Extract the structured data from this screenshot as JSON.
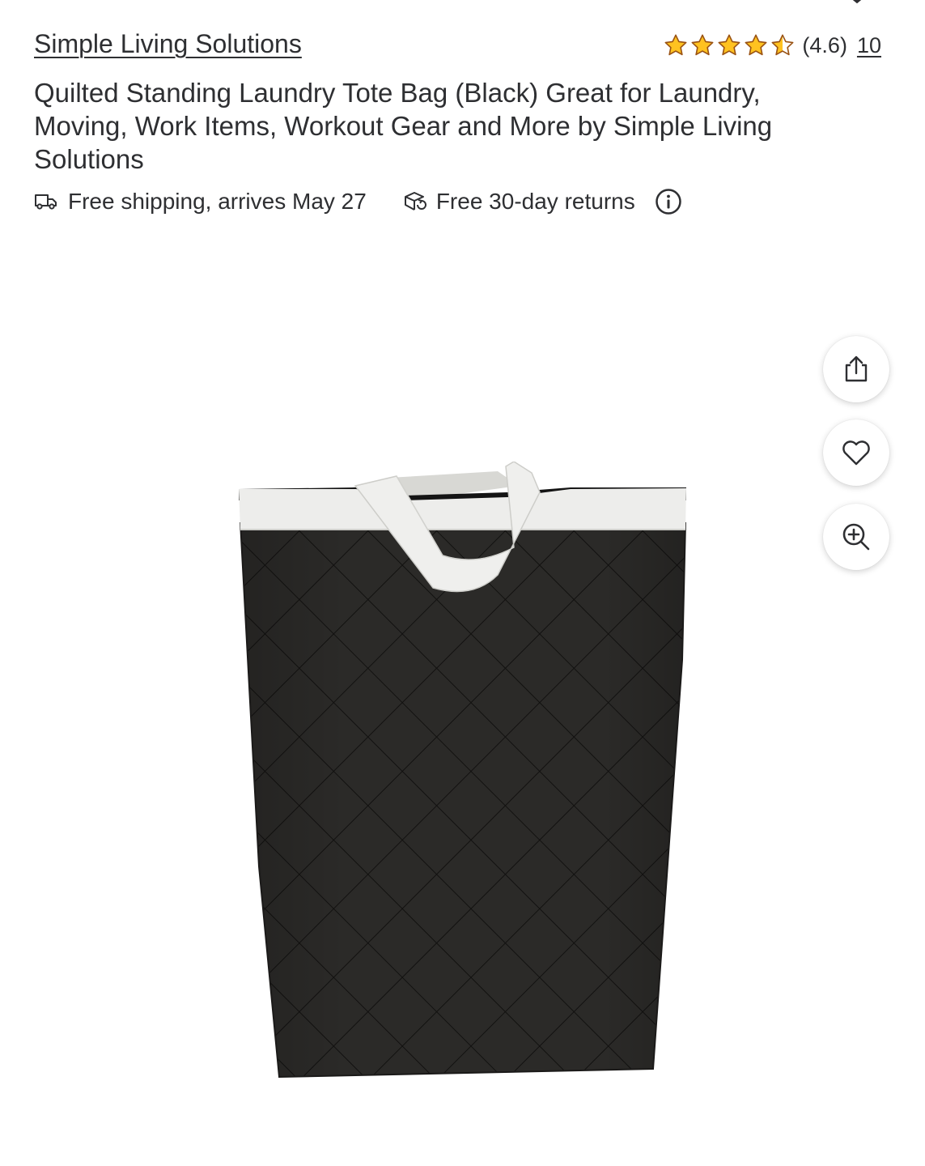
{
  "header": {
    "brand": "Simple Living Solutions",
    "rating_value": "(4.6)",
    "rating_stars": 4.6,
    "review_count": "10"
  },
  "product": {
    "title": "Quilted Standing Laundry Tote Bag (Black) Great for Laundry, Moving, Work Items, Workout Gear and More by Simple Living Solutions"
  },
  "fulfillment": {
    "shipping": "Free shipping, arrives May 27",
    "returns": "Free 30-day returns"
  },
  "icons": {
    "close": "close-icon",
    "shipping": "truck-icon",
    "returns": "return-box-icon",
    "info": "info-icon",
    "share": "share-icon",
    "favorite": "heart-icon",
    "zoom": "zoom-in-icon"
  },
  "colors": {
    "star": "#ffc220",
    "star_outline": "#995213",
    "text": "#2e2f32",
    "bag": "#2b2a28",
    "handle": "#ededeb"
  }
}
